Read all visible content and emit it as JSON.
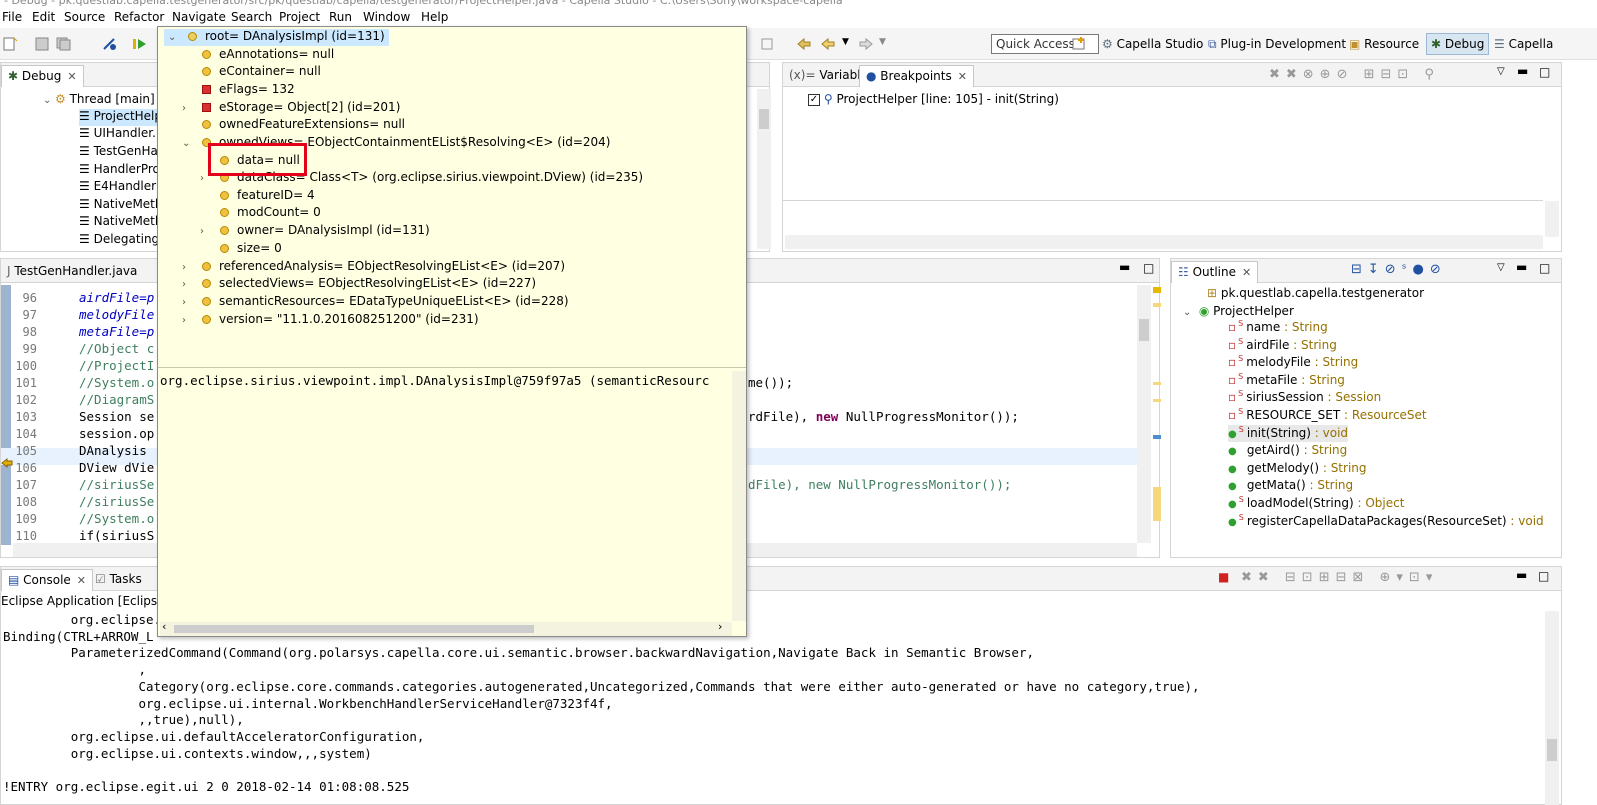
{
  "window_title": "- Debug - pk.questlab.capella.testgenerator/src/pk/questlab/capella/testgenerator/ProjectHelper.java - Capella Studio - C:\\Users\\Sony\\workspace-capella",
  "menu": [
    "File",
    "Edit",
    "Source",
    "Refactor",
    "Navigate",
    "Search",
    "Project",
    "Run",
    "Window",
    "Help"
  ],
  "quick_access": "Quick Access",
  "perspectives": [
    "Capella Studio",
    "Plug-in Development",
    "Resource",
    "Debug",
    "Capella"
  ],
  "debug_view": {
    "tab": "Debug",
    "thread": "Thread [main]",
    "frames": [
      "ProjectHelp",
      "UIHandler.i",
      "TestGenHan",
      "HandlerPro",
      "E4HandlerP",
      "NativeMeth",
      "NativeMeth",
      "Delegating"
    ]
  },
  "variables_view": {
    "tabs": [
      "Variables",
      "Breakpoints"
    ],
    "breakpoint": "ProjectHelper [line: 105] - init(String)"
  },
  "editor": {
    "tab": "TestGenHandler.java",
    "lines": [
      {
        "n": "96",
        "t": "airdFile=p"
      },
      {
        "n": "97",
        "t": "melodyFile"
      },
      {
        "n": "98",
        "t": "metaFile=p"
      },
      {
        "n": "99",
        "t": "//Object c"
      },
      {
        "n": "100",
        "t": "//ProjectI"
      },
      {
        "n": "101",
        "t": "//System.o"
      },
      {
        "n": "102",
        "t": "//DiagramS"
      },
      {
        "n": "103",
        "t": "Session se"
      },
      {
        "n": "104",
        "t": "session.op"
      },
      {
        "n": "105",
        "t": "DAnalysis "
      },
      {
        "n": "106",
        "t": "DView dVie"
      },
      {
        "n": "107",
        "t": "//siriusSe"
      },
      {
        "n": "108",
        "t": "//siriusSe"
      },
      {
        "n": "109",
        "t": "//System.o"
      },
      {
        "n": "110",
        "t": "if(siriusS"
      }
    ],
    "tail_101": "me());",
    "tail_103a": "rdFile), ",
    "tail_103b": "new",
    "tail_103c": " NullProgressMonitor());",
    "tail_107": "dFile), new NullProgressMonitor());"
  },
  "popup": {
    "root": "root= DAnalysisImpl  (id=131)",
    "items": [
      "eAnnotations= null",
      "eContainer= null",
      "eFlags= 132",
      "eStorage= Object[2]  (id=201)",
      "ownedFeatureExtensions= null",
      "ownedViews= EObjectContainmentEList$Resolving<E>  (id=204)",
      "data= null",
      "dataClass= Class<T> (org.eclipse.sirius.viewpoint.DView) (id=235)",
      "featureID= 4",
      "modCount= 0",
      "owner= DAnalysisImpl  (id=131)",
      "size= 0",
      "referencedAnalysis= EObjectResolvingEList<E>  (id=207)",
      "selectedViews= EObjectResolvingEList<E>  (id=227)",
      "semanticResources= EDataTypeUniqueEList<E>  (id=228)",
      "version= \"11.1.0.201608251200\" (id=231)"
    ],
    "detail": "org.eclipse.sirius.viewpoint.impl.DAnalysisImpl@759f97a5 (semanticResourc"
  },
  "outline": {
    "tab": "Outline",
    "package": "pk.questlab.capella.testgenerator",
    "class": "ProjectHelper",
    "members": [
      {
        "name": "name",
        "type": " : String"
      },
      {
        "name": "airdFile",
        "type": " : String"
      },
      {
        "name": "melodyFile",
        "type": " : String"
      },
      {
        "name": "metaFile",
        "type": " : String"
      },
      {
        "name": "siriusSession",
        "type": " : Session"
      },
      {
        "name": "RESOURCE_SET",
        "type": " : ResourceSet"
      },
      {
        "name": "init(String)",
        "type": " : void"
      },
      {
        "name": "getAird()",
        "type": " : String"
      },
      {
        "name": "getMelody()",
        "type": " : String"
      },
      {
        "name": "getMata()",
        "type": " : String"
      },
      {
        "name": "loadModel(String)",
        "type": " : Object"
      },
      {
        "name": "registerCapellaDataPackages(ResourceSet)",
        "type": " : void"
      }
    ]
  },
  "console": {
    "tabs": [
      "Console",
      "Tasks"
    ],
    "header": "Eclipse Application [Eclipse Ap",
    "lines": [
      "         org.eclipse.",
      "Binding(CTRL+ARROW_L",
      "         ParameterizedCommand(Command(org.polarsys.capella.core.ui.semantic.browser.backwardNavigation,Navigate Back in Semantic Browser,",
      "                  ,",
      "                  Category(org.eclipse.core.commands.categories.autogenerated,Uncategorized,Commands that were either auto-generated or have no category,true),",
      "                  org.eclipse.ui.internal.WorkbenchHandlerServiceHandler@7323f4f,",
      "                  ,,true),null),",
      "         org.eclipse.ui.defaultAcceleratorConfiguration,",
      "         org.eclipse.ui.contexts.window,,,system)",
      "",
      "!ENTRY org.eclipse.egit.ui 2 0 2018-02-14 01:08:08.525"
    ]
  },
  "colors": {
    "popup_bg": "#ffffe1",
    "highlight": "#e3001b",
    "selection": "#cce8ff"
  }
}
